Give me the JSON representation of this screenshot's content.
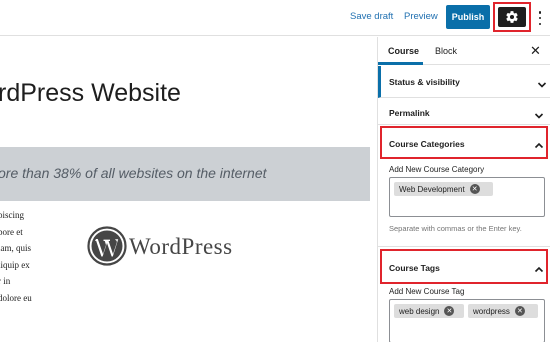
{
  "toolbar": {
    "save_draft": "Save draft",
    "preview": "Preview",
    "publish": "Publish",
    "settings_icon": "gear-icon",
    "more_icon": "vertical-ellipsis-icon"
  },
  "editor": {
    "title": "rdPress Website",
    "quote": "ore than 38% of all websites on the internet",
    "paragraph_lines": [
      "piscing",
      "bore et",
      "iam, quis",
      "liquip ex",
      "r in",
      "dolore eu"
    ],
    "image_text": "WordPress"
  },
  "sidebar": {
    "tabs": [
      "Course",
      "Block"
    ],
    "active_tab": "Course",
    "close_icon": "close-icon",
    "panels": {
      "status": "Status & visibility",
      "permalink": "Permalink",
      "categories": "Course Categories",
      "tags": "Course Tags"
    },
    "categories": {
      "label": "Add New Course Category",
      "tokens": [
        "Web Development"
      ],
      "help": "Separate with commas or the Enter key."
    },
    "tags": {
      "label": "Add New Course Tag",
      "tokens": [
        "web design",
        "wordpress"
      ]
    }
  },
  "colors": {
    "accent": "#0a6fa9",
    "highlight": "#e0242c",
    "quote_bg": "#ccd0d4"
  }
}
